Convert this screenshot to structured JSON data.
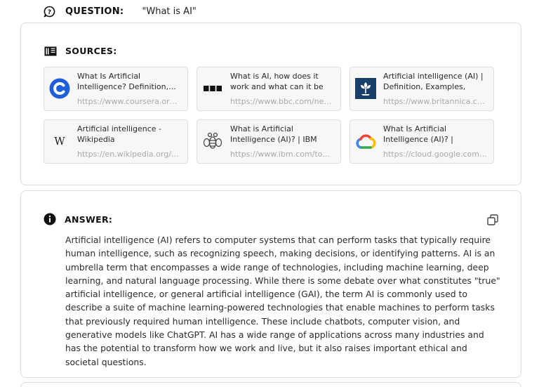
{
  "question": {
    "icon": "speech-bubble-question-icon",
    "label": "QUESTION:",
    "text": "\"What is AI\""
  },
  "sources": {
    "icon": "book-icon",
    "label": "SOURCES:",
    "items": [
      {
        "title": "What Is Artificial Intelligence? Definition,...",
        "url": "https://www.coursera.org/...",
        "logo": "coursera-logo"
      },
      {
        "title": "What is AI, how does it work and what can it be used for...",
        "url": "https://www.bbc.com/new...",
        "logo": "bbc-logo"
      },
      {
        "title": "Artificial intelligence (AI) | Definition, Examples, Types...",
        "url": "https://www.britannica.co...",
        "logo": "britannica-logo"
      },
      {
        "title": "Artificial intelligence - Wikipedia",
        "url": "https://en.wikipedia.org/wi...",
        "logo": "wikipedia-logo"
      },
      {
        "title": "What is Artificial Intelligence (AI)? | IBM",
        "url": "https://www.ibm.com/topi...",
        "logo": "ibm-bee-logo"
      },
      {
        "title": "What Is Artificial Intelligence (AI)? | Google...",
        "url": "https://cloud.google.com/...",
        "logo": "google-cloud-logo"
      }
    ]
  },
  "answer": {
    "icon": "info-icon",
    "label": "ANSWER:",
    "copy_icon": "copy-icon",
    "text": "Artificial intelligence (AI) refers to computer systems that can perform tasks that typically require human intelligence, such as recognizing speech, making decisions, or identifying patterns. AI is an umbrella term that encompasses a wide range of technologies, including machine learning, deep learning, and natural language processing. While there is some debate over what constitutes \"true\" artificial intelligence, or general artificial intelligence (GAI), the term AI is commonly used to describe a suite of machine learning-powered technologies that enable machines to perform tasks that previously required human intelligence. These include chatbots, computer vision, and generative models like ChatGPT. AI has a wide range of applications across many industries and has the potential to transform how we work and live, but it also raises important ethical and societal questions."
  },
  "colors": {
    "coursera": "#1f5ed8",
    "britannica": "#18406b",
    "border": "#dcdcdc",
    "url_gray": "#a9a9a9"
  }
}
